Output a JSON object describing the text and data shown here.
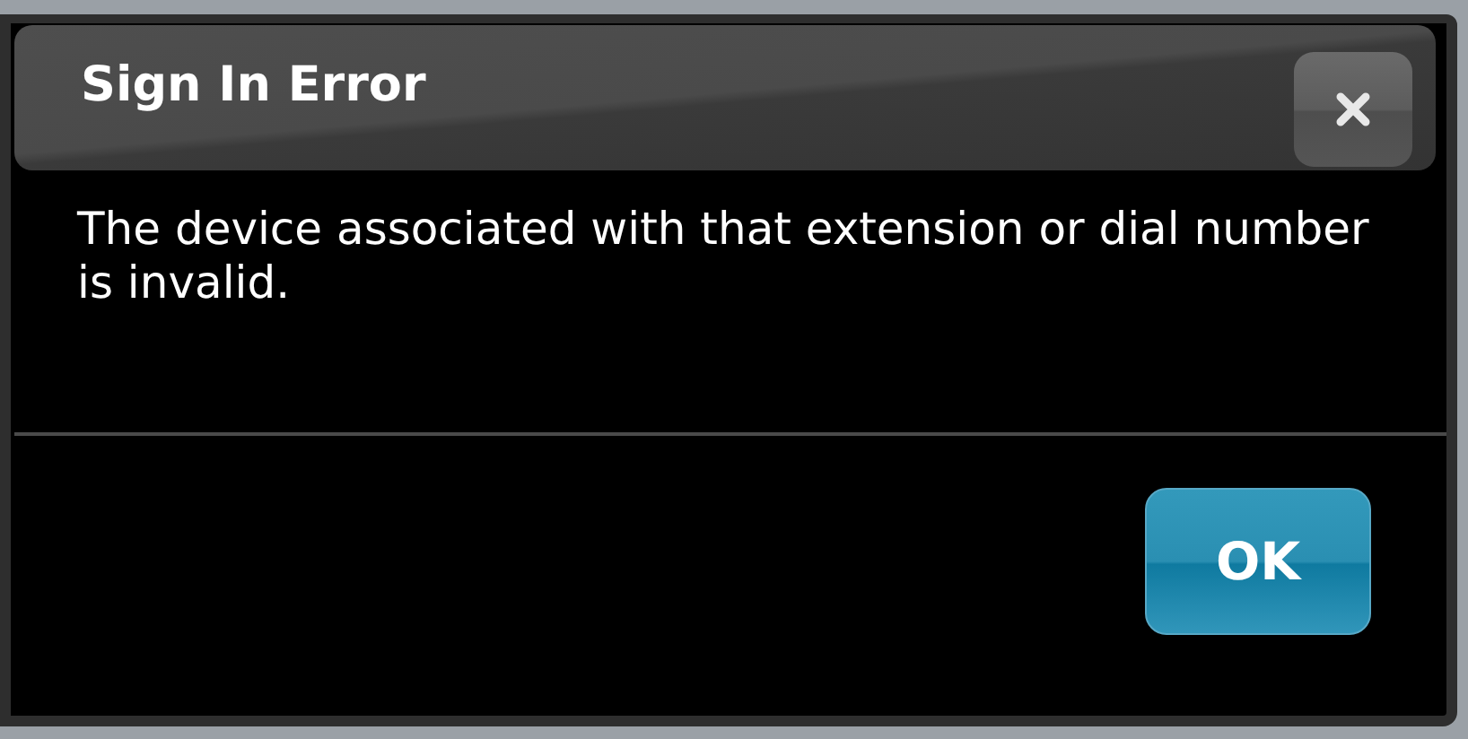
{
  "dialog": {
    "title": "Sign In Error",
    "message": "The device associated with that extension or dial number is invalid.",
    "buttons": [
      "OK"
    ]
  }
}
